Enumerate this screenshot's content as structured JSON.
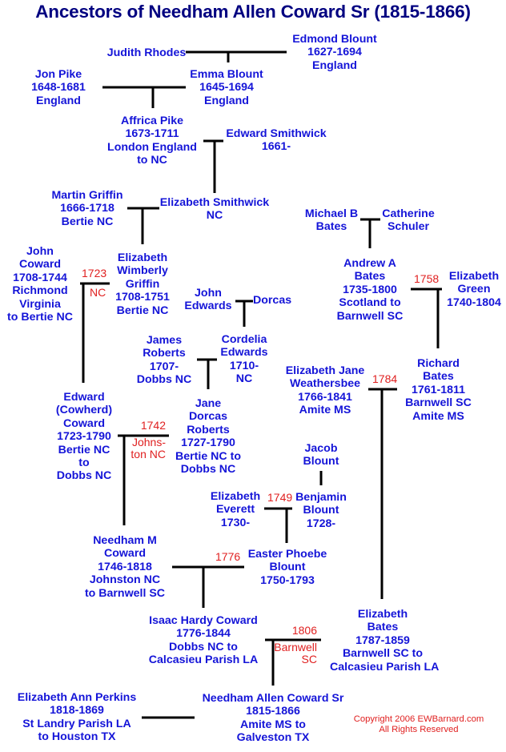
{
  "title": "Ancestors of Needham Allen Coward Sr (1815-1866)",
  "people": [
    {
      "id": "edmond-blount",
      "lines": [
        "Edmond Blount",
        "1627-1694",
        "England"
      ]
    },
    {
      "id": "judith-rhodes",
      "lines": [
        "Judith Rhodes"
      ]
    },
    {
      "id": "jon-pike",
      "lines": [
        "Jon Pike",
        "1648-1681",
        "England"
      ]
    },
    {
      "id": "emma-blount",
      "lines": [
        "Emma Blount",
        "1645-1694",
        "England"
      ]
    },
    {
      "id": "affrica-pike",
      "lines": [
        "Affrica Pike",
        "1673-1711",
        "London England",
        "to NC"
      ]
    },
    {
      "id": "edward-smithwick",
      "lines": [
        "Edward Smithwick",
        "1661-"
      ]
    },
    {
      "id": "martin-griffin",
      "lines": [
        "Martin Griffin",
        "1666-1718",
        "Bertie NC"
      ]
    },
    {
      "id": "elizabeth-smithwick",
      "lines": [
        "Elizabeth Smithwick",
        "NC"
      ]
    },
    {
      "id": "michael-b-bates",
      "lines": [
        "Michael B",
        "Bates"
      ]
    },
    {
      "id": "catherine-schuler",
      "lines": [
        "Catherine",
        "Schuler"
      ]
    },
    {
      "id": "john-coward",
      "lines": [
        "John",
        "Coward",
        "1708-1744",
        "Richmond",
        "Virginia",
        "to Bertie NC"
      ]
    },
    {
      "id": "elizabeth-wimberly-griffin",
      "lines": [
        "Elizabeth",
        "Wimberly",
        "Griffin",
        "1708-1751",
        "Bertie NC"
      ]
    },
    {
      "id": "andrew-a-bates",
      "lines": [
        "Andrew A",
        "Bates",
        "1735-1800",
        "Scotland to",
        "Barnwell SC"
      ]
    },
    {
      "id": "elizabeth-green",
      "lines": [
        "Elizabeth",
        "Green",
        "1740-1804"
      ]
    },
    {
      "id": "john-edwards",
      "lines": [
        "John",
        "Edwards"
      ]
    },
    {
      "id": "dorcas",
      "lines": [
        "Dorcas"
      ]
    },
    {
      "id": "james-roberts",
      "lines": [
        "James",
        "Roberts",
        "1707-",
        "Dobbs NC"
      ]
    },
    {
      "id": "cordelia-edwards",
      "lines": [
        "Cordelia",
        "Edwards",
        "1710-",
        "NC"
      ]
    },
    {
      "id": "elizabeth-jane-weathersbee",
      "lines": [
        "Elizabeth Jane",
        "Weathersbee",
        "1766-1841",
        "Amite MS"
      ]
    },
    {
      "id": "richard-bates",
      "lines": [
        "Richard",
        "Bates",
        "1761-1811",
        "Barnwell SC",
        "Amite MS"
      ]
    },
    {
      "id": "edward-cowherd-coward",
      "lines": [
        "Edward",
        "(Cowherd)",
        "Coward",
        "1723-1790",
        "Bertie NC",
        "to",
        "Dobbs NC"
      ]
    },
    {
      "id": "jane-dorcas-roberts",
      "lines": [
        "Jane",
        "Dorcas",
        "Roberts",
        "1727-1790",
        "Bertie NC to",
        "Dobbs NC"
      ]
    },
    {
      "id": "jacob-blount",
      "lines": [
        "Jacob",
        "Blount"
      ]
    },
    {
      "id": "elizabeth-everett",
      "lines": [
        "Elizabeth",
        "Everett",
        "1730-"
      ]
    },
    {
      "id": "benjamin-blount",
      "lines": [
        "Benjamin",
        "Blount",
        "1728-"
      ]
    },
    {
      "id": "needham-m-coward",
      "lines": [
        "Needham M",
        "Coward",
        "1746-1818",
        "Johnston NC",
        "to Barnwell SC"
      ]
    },
    {
      "id": "easter-phoebe-blount",
      "lines": [
        "Easter Phoebe",
        "Blount",
        "1750-1793"
      ]
    },
    {
      "id": "isaac-hardy-coward",
      "lines": [
        "Isaac Hardy Coward",
        "1776-1844",
        "Dobbs NC to",
        "Calcasieu Parish LA"
      ]
    },
    {
      "id": "elizabeth-bates",
      "lines": [
        "Elizabeth",
        "Bates",
        "1787-1859",
        "Barnwell SC to",
        "Calcasieu Parish LA"
      ]
    },
    {
      "id": "elizabeth-ann-perkins",
      "lines": [
        "Elizabeth Ann Perkins",
        "1818-1869",
        "St Landry Parish LA",
        "to Houston TX"
      ]
    },
    {
      "id": "needham-allen-coward-sr",
      "lines": [
        "Needham Allen Coward Sr",
        "1815-1866",
        "Amite MS to",
        "Galveston TX"
      ]
    }
  ],
  "marriages": [
    {
      "id": "m1723",
      "lines": [
        "1723",
        "NC"
      ]
    },
    {
      "id": "m1758",
      "lines": [
        "1758"
      ]
    },
    {
      "id": "m1784",
      "lines": [
        "1784"
      ]
    },
    {
      "id": "m1742",
      "lines": [
        "1742",
        "Johns-",
        "ton NC"
      ]
    },
    {
      "id": "m1749",
      "lines": [
        "1749"
      ]
    },
    {
      "id": "m1776",
      "lines": [
        "1776"
      ]
    },
    {
      "id": "m1806",
      "lines": [
        "1806",
        "Barnwell",
        "SC"
      ]
    }
  ],
  "copyright": [
    "Copyright 2006 EWBarnard.com",
    "All Rights Reserved"
  ],
  "colors": {
    "title": "#000080",
    "person_text": "#1414d8",
    "marriage_text": "#e02020",
    "lines": "#000000",
    "background": "#ffffff"
  }
}
